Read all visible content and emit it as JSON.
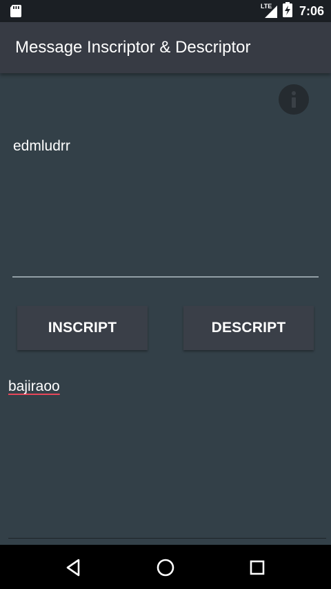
{
  "status_bar": {
    "time": "7:06",
    "network_label": "LTE"
  },
  "app_bar": {
    "title": "Message Inscriptor & Descriptor"
  },
  "input_field": {
    "value": "edmludrr"
  },
  "buttons": {
    "inscript_label": "INSCRIPT",
    "descript_label": "DESCRIPT"
  },
  "output_field": {
    "value": "bajiraoo"
  },
  "colors": {
    "background": "#334048",
    "app_bar": "#373b44",
    "button": "#3a3f48",
    "spellcheck_underline": "#e8475a"
  },
  "icons": {
    "info": "info-icon",
    "sd_card": "sd-card-icon",
    "signal": "signal-icon",
    "battery": "battery-charging-icon",
    "back": "back-triangle-icon",
    "home": "home-circle-icon",
    "recents": "recents-square-icon"
  }
}
